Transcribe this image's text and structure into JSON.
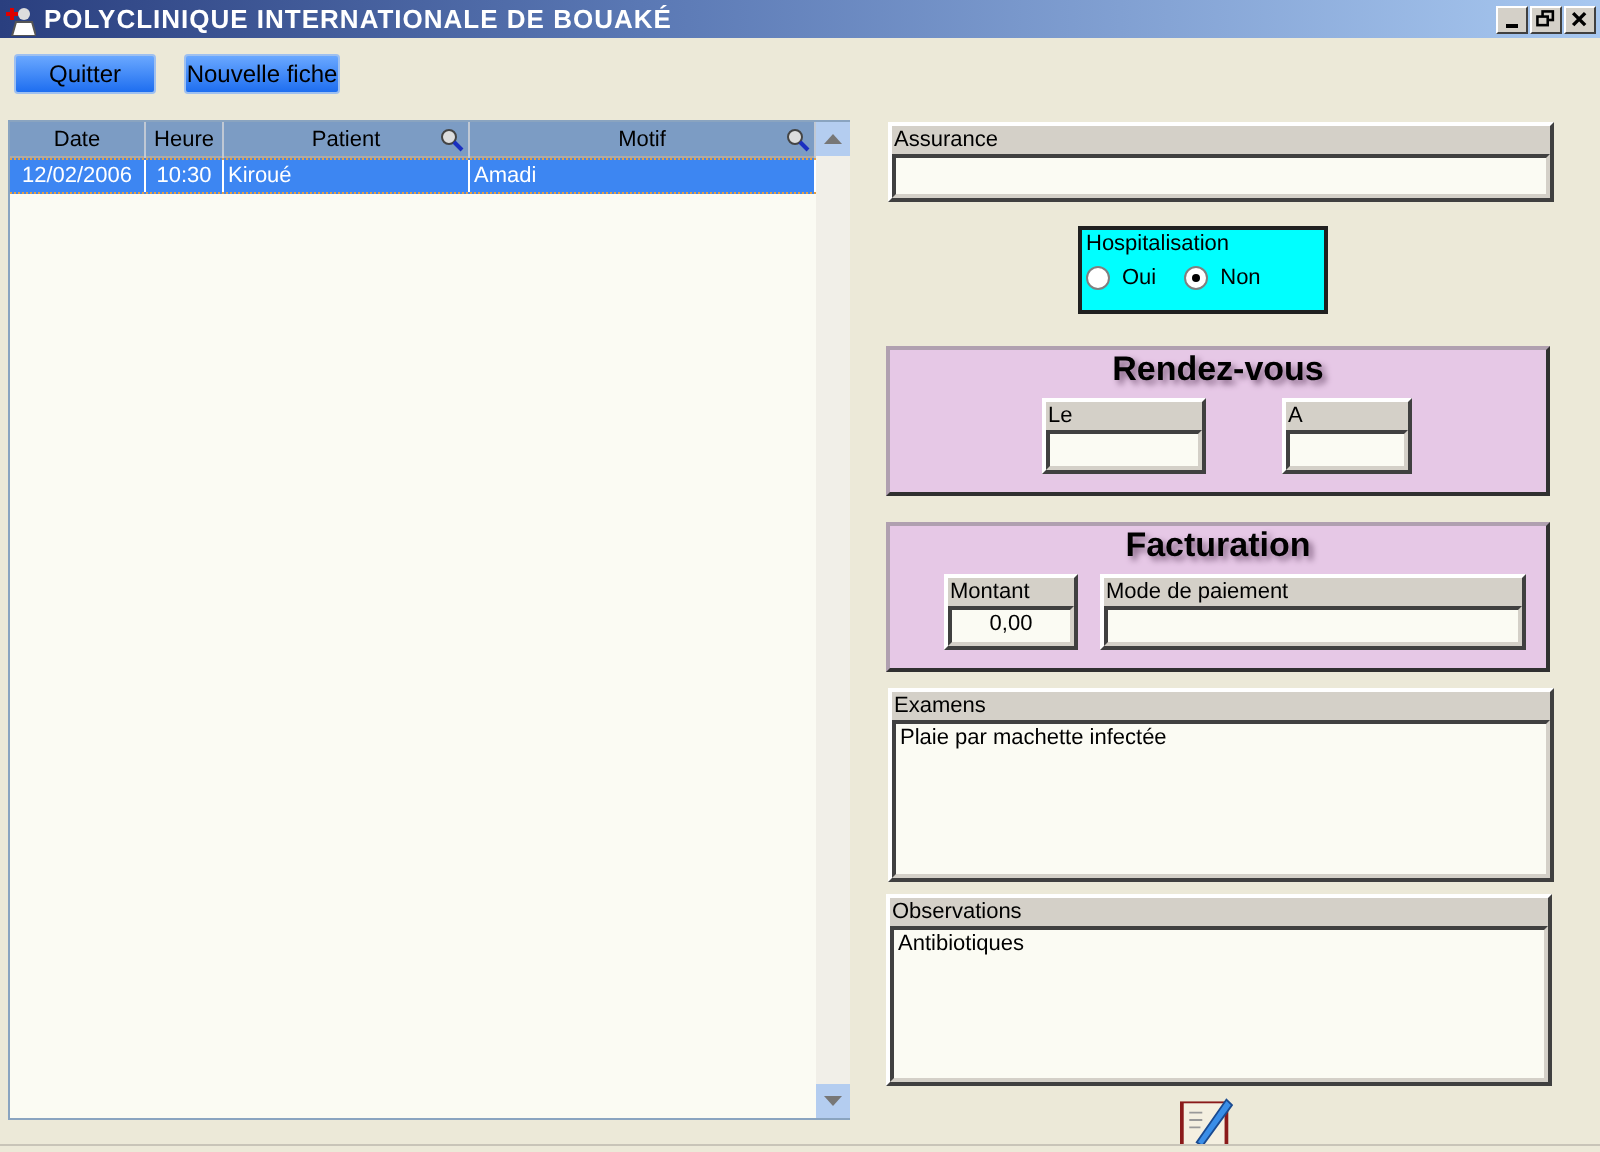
{
  "window": {
    "title": "POLYCLINIQUE INTERNATIONALE DE BOUAKÉ"
  },
  "buttons": [
    {
      "label": "Quitter"
    },
    {
      "label": "Nouvelle fiche"
    }
  ],
  "table": {
    "columns": [
      {
        "label": "Date",
        "searchable": false
      },
      {
        "label": "Heure",
        "searchable": false
      },
      {
        "label": "Patient",
        "searchable": true
      },
      {
        "label": "Motif",
        "searchable": true
      }
    ],
    "rows": [
      {
        "cells": [
          "12/02/2006",
          "10:30",
          "Kiroué",
          "Amadi"
        ],
        "selected": true
      }
    ]
  },
  "assurance": {
    "label": "Assurance"
  },
  "hospitalisation": {
    "label": "Hospitalisation",
    "options": [
      {
        "label": "Oui",
        "selected": false
      },
      {
        "label": "Non",
        "selected": true
      }
    ]
  },
  "rendez_vous": {
    "title": "Rendez-vous",
    "fields": [
      {
        "label": "Le"
      },
      {
        "label": "A"
      }
    ]
  },
  "facturation": {
    "title": "Facturation",
    "fields": [
      {
        "label": "Montant",
        "value": "0,00"
      },
      {
        "label": "Mode de paiement"
      }
    ]
  },
  "examens": {
    "label": "Examens",
    "value": "Plaie par machette infectée"
  },
  "observations": {
    "label": "Observations",
    "value": "Antibiotiques"
  }
}
